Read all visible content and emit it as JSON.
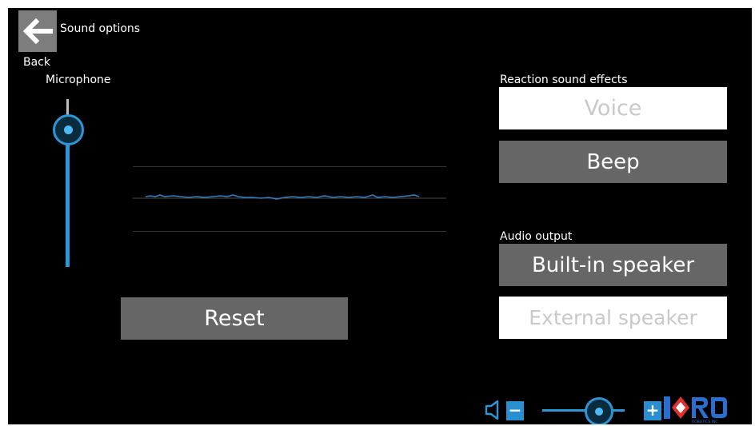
{
  "header": {
    "title": "Sound options",
    "back_label": "Back"
  },
  "microphone": {
    "label": "Microphone",
    "level": 0.9
  },
  "buttons": {
    "reset": "Reset"
  },
  "reaction_sound_effects": {
    "label": "Reaction sound effects",
    "options": [
      {
        "label": "Voice",
        "selected": false
      },
      {
        "label": "Beep",
        "selected": true
      }
    ]
  },
  "audio_output": {
    "label": "Audio output",
    "options": [
      {
        "label": "Built-in speaker",
        "selected": true
      },
      {
        "label": "External speaker",
        "selected": false
      }
    ]
  },
  "volume": {
    "level": 0.7
  },
  "logo": {
    "text": "RO",
    "subtitle": "ROBOTICS INC."
  },
  "icons": [
    "back-arrow-icon",
    "speaker-icon",
    "minus-icon",
    "plus-icon"
  ],
  "colors": {
    "accent": "#2b97d6",
    "background": "#000000",
    "button_grey": "#666666",
    "button_white": "#ffffff"
  }
}
